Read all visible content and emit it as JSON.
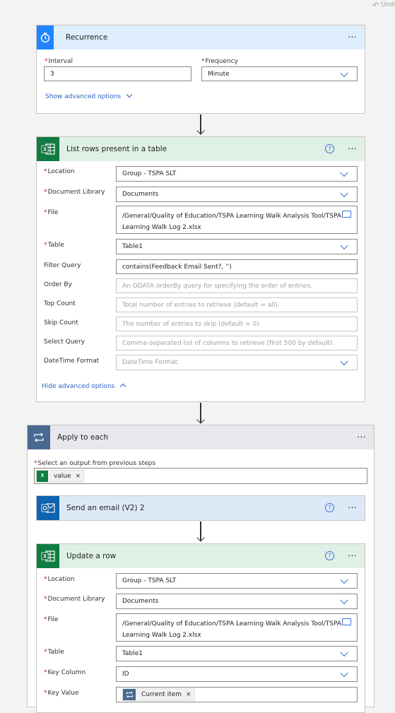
{
  "topbar": {
    "undo_label": "Undo"
  },
  "recurrence": {
    "title": "Recurrence",
    "interval_label": "Interval",
    "interval_value": "3",
    "frequency_label": "Frequency",
    "frequency_value": "Minute",
    "advanced_link": "Show advanced options"
  },
  "list_rows": {
    "title": "List rows present in a table",
    "location_label": "Location",
    "location_value": "Group - TSPA SLT",
    "doclib_label": "Document Library",
    "doclib_value": "Documents",
    "file_label": "File",
    "file_value_line1": "/General/Quality of Education/TSPA Learning Walk Analysis Tool/TSPA",
    "file_value_line2": "Learning Walk Log 2.xlsx",
    "table_label": "Table",
    "table_value": "Table1",
    "filter_label": "Filter Query",
    "filter_value": "contains(Feedback Email Sent?, '')",
    "orderby_label": "Order By",
    "orderby_placeholder": "An ODATA orderBy query for specifying the order of entries.",
    "topcount_label": "Top Count",
    "topcount_placeholder": "Total number of entries to retrieve (default = all).",
    "skipcount_label": "Skip Count",
    "skipcount_placeholder": "The number of entries to skip (default = 0).",
    "select_label": "Select Query",
    "select_placeholder": "Comma-separated list of columns to retrieve (first 500 by default).",
    "datetime_label": "DateTime Format",
    "datetime_placeholder": "DateTime Format.",
    "advanced_link": "Hide advanced options"
  },
  "apply_each": {
    "title": "Apply to each",
    "select_label": "Select an output from previous steps",
    "token_label": "value"
  },
  "send_email": {
    "title": "Send an email (V2) 2"
  },
  "update_row": {
    "title": "Update a row",
    "location_label": "Location",
    "location_value": "Group - TSPA SLT",
    "doclib_label": "Document Library",
    "doclib_value": "Documents",
    "file_label": "File",
    "file_value_line1": "/General/Quality of Education/TSPA Learning Walk Analysis Tool/TSPA",
    "file_value_line2": "Learning Walk Log 2.xlsx",
    "table_label": "Table",
    "table_value": "Table1",
    "keycol_label": "Key Column",
    "keycol_value": "ID",
    "keyval_label": "Key Value",
    "keyval_token": "Current item"
  },
  "icons": {
    "more": "⋯",
    "help": "?",
    "close": "×"
  },
  "colors": {
    "recurrence_header": "#dfeefc",
    "recurrence_icon": "#1f85ff",
    "excel_header": "#dff0e6",
    "excel_icon": "#107c41",
    "apply_header": "#e6e8ed",
    "apply_icon": "#486991",
    "outlook_header": "#dde9f7",
    "outlook_icon": "#0f63b0",
    "link": "#2b63c3",
    "required": "#a4262c"
  }
}
